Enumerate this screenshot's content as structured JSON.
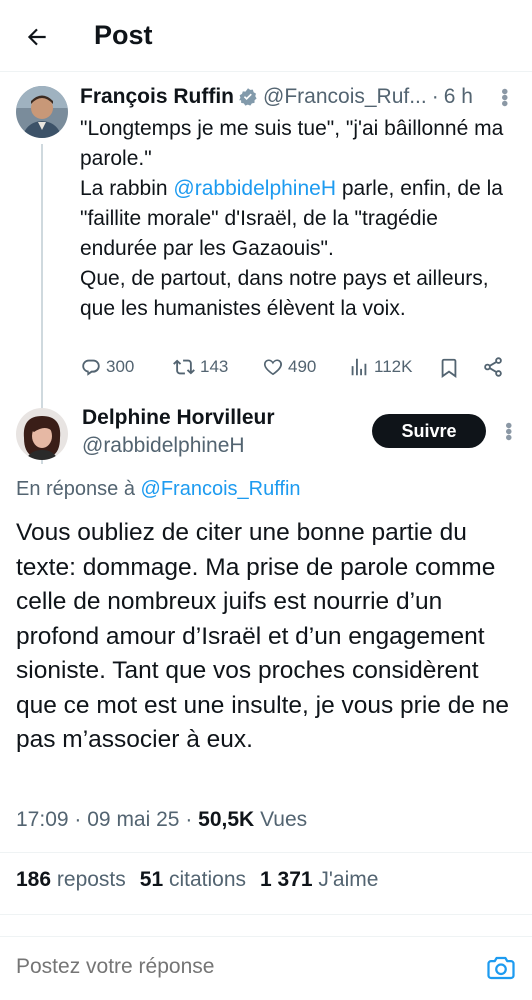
{
  "header": {
    "title": "Post",
    "back_icon": "arrow-left-icon"
  },
  "parent_post": {
    "author_name": "François Ruffin",
    "verified": true,
    "handle": "@Francois_Ruf...",
    "separator": "·",
    "time": "6 h",
    "text": {
      "line1": "\"Longtemps je me suis tue\", \"j'ai bâillonné ma parole.\"",
      "line2_before": "La rabbin ",
      "line2_mention": "@rabbidelphineH",
      "line2_after": "  parle, enfin, de la \"faillite morale\" d'Israël, de la \"tragédie endurée par les Gazaouis\".",
      "line3": "Que, de partout, dans notre pays et ailleurs, que les humanistes élèvent la voix."
    },
    "actions": {
      "replies": "300",
      "reposts": "143",
      "likes": "490",
      "views": "112K"
    }
  },
  "reply_post": {
    "author_name": "Delphine Horvilleur",
    "handle": "@rabbidelphineH",
    "follow_label": "Suivre",
    "reply_to_prefix": "En réponse à ",
    "reply_to_handle": "@Francois_Ruffin",
    "text": "Vous oubliez de citer une bonne partie du texte: dommage. Ma prise de parole comme celle de nombreux juifs est nourrie d’un profond amour d’Israël et d’un engagement sioniste. Tant que vos proches considèrent que ce mot est une insulte, je vous prie de ne pas m’associer à eux.",
    "time": "17:09",
    "date": "09 mai 25",
    "separator": "·",
    "views_count": "50,5K",
    "views_label": "Vues",
    "stats": {
      "reposts_count": "186",
      "reposts_label": "reposts",
      "quotes_count": "51",
      "quotes_label": "citations",
      "likes_count": "1 371",
      "likes_label": "J'aime"
    }
  },
  "composer": {
    "placeholder": "Postez votre réponse"
  },
  "colors": {
    "accent": "#1d9bf0",
    "text": "#0f1419",
    "secondary": "#536471",
    "border": "#eff3f4"
  }
}
